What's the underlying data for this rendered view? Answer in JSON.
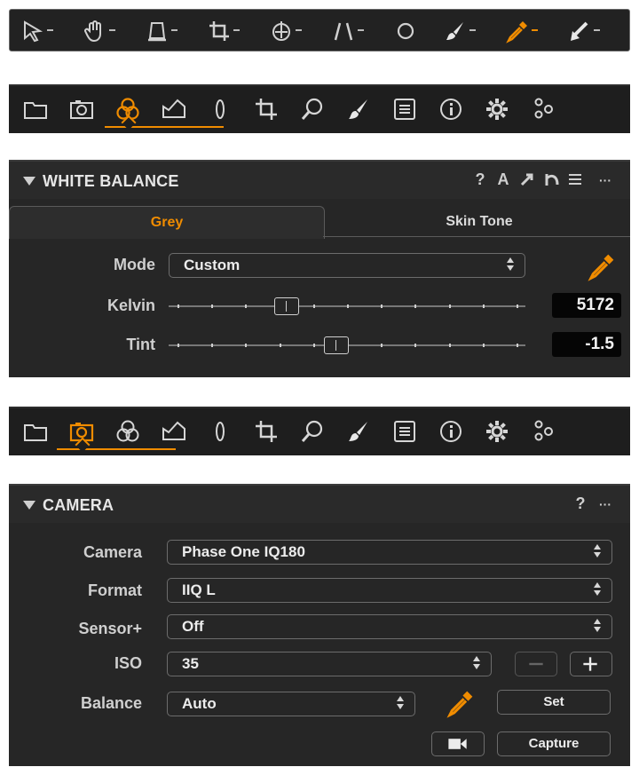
{
  "toolbar": {
    "tools": [
      {
        "icon": "cursor-arrow-icon",
        "has_menu": true
      },
      {
        "icon": "pan-hand-icon",
        "has_menu": true
      },
      {
        "icon": "loupe-icon",
        "has_menu": true
      },
      {
        "icon": "crop-icon",
        "has_menu": true
      },
      {
        "icon": "rotate-icon",
        "has_menu": true
      },
      {
        "icon": "keystone-icon",
        "has_menu": true
      },
      {
        "icon": "circle-icon",
        "has_menu": false
      },
      {
        "icon": "brush-icon",
        "has_menu": true
      },
      {
        "icon": "color-picker-icon",
        "has_menu": true,
        "active": true
      },
      {
        "icon": "annotate-pen-icon",
        "has_menu": true
      }
    ]
  },
  "tabbar_1": {
    "tabs": [
      "library",
      "capture",
      "color",
      "exposure",
      "lens",
      "crop",
      "details",
      "local-adjust",
      "metadata",
      "info",
      "output",
      "settings"
    ],
    "active": "color"
  },
  "white_balance": {
    "title": "WHITE BALANCE",
    "header_icons": [
      "?",
      "A",
      "⤢",
      "↶",
      "≡",
      "···"
    ],
    "tabs": {
      "grey": "Grey",
      "skin_tone": "Skin Tone"
    },
    "mode_label": "Mode",
    "mode_value": "Custom",
    "kelvin_label": "Kelvin",
    "kelvin_value": "5172",
    "kelvin_position": 0.33,
    "tint_label": "Tint",
    "tint_value": "-1.5",
    "tint_position": 0.47
  },
  "tabbar_2": {
    "tabs": [
      "library",
      "capture",
      "color",
      "exposure",
      "lens",
      "crop",
      "details",
      "local-adjust",
      "metadata",
      "info",
      "output",
      "settings"
    ],
    "active": "capture"
  },
  "camera": {
    "title": "CAMERA",
    "header_icons": [
      "?",
      "···"
    ],
    "camera_label": "Camera",
    "camera_value": "Phase One IQ180",
    "format_label": "Format",
    "format_value": "IIQ L",
    "sensor_label": "Sensor+",
    "sensor_value": "Off",
    "iso_label": "ISO",
    "iso_value": "35",
    "balance_label": "Balance",
    "balance_value": "Auto",
    "set_label": "Set",
    "capture_label": "Capture"
  },
  "colors": {
    "accent": "#f08c00",
    "panel": "#262626",
    "toolbar": "#1d1d1d"
  }
}
